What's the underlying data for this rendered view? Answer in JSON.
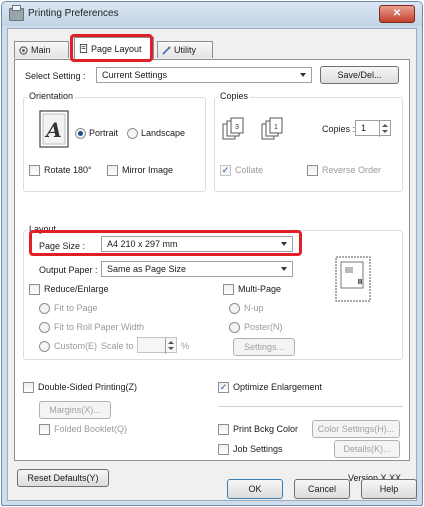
{
  "window": {
    "title": "Printing Preferences",
    "close_glyph": "✕"
  },
  "tabs": [
    {
      "label": "Main",
      "icon": "main-tab-icon"
    },
    {
      "label": "Page Layout",
      "icon": "page-layout-icon"
    },
    {
      "label": "Utility",
      "icon": "utility-icon"
    }
  ],
  "select_setting": {
    "label": "Select Setting :",
    "value": "Current Settings",
    "save_del": "Save/Del..."
  },
  "orientation": {
    "title": "Orientation",
    "portrait": "Portrait",
    "landscape": "Landscape",
    "rotate": "Rotate 180°",
    "mirror": "Mirror Image",
    "selected": "Portrait"
  },
  "copies": {
    "title": "Copies",
    "label": "Copies :",
    "value": "1",
    "collate": "Collate",
    "reverse": "Reverse Order"
  },
  "layout": {
    "title": "Layout",
    "page_size_label": "Page Size :",
    "page_size_value": "A4 210 x 297 mm",
    "output_paper_label": "Output Paper :",
    "output_paper_value": "Same as Page Size",
    "reduce_enlarge": "Reduce/Enlarge",
    "fit_to_page": "Fit to Page",
    "fit_roll": "Fit to Roll Paper Width",
    "custom": "Custom(E)",
    "scale_to": "Scale to",
    "scale_unit": "%",
    "multi_page": "Multi-Page",
    "n_up": "N-up",
    "poster": "Poster(N)",
    "settings_btn": "Settings..."
  },
  "double_sided": {
    "label": "Double-Sided Printing(Z)",
    "margins_btn": "Margins(X)...",
    "folded": "Folded Booklet(Q)"
  },
  "optimize": {
    "label": "Optimize Enlargement",
    "checked": true
  },
  "print_bkg": {
    "label": "Print Bckg Color",
    "color_btn": "Color Settings(H)..."
  },
  "job_settings": {
    "label": "Job Settings",
    "details_btn": "Details(K)..."
  },
  "reset_defaults": "Reset Defaults(Y)",
  "version": "Version X.XX",
  "footer": {
    "ok": "OK",
    "cancel": "Cancel",
    "help": "Help"
  },
  "colors": {
    "highlight": "#e21e26",
    "accent": "#1d4f8c"
  }
}
